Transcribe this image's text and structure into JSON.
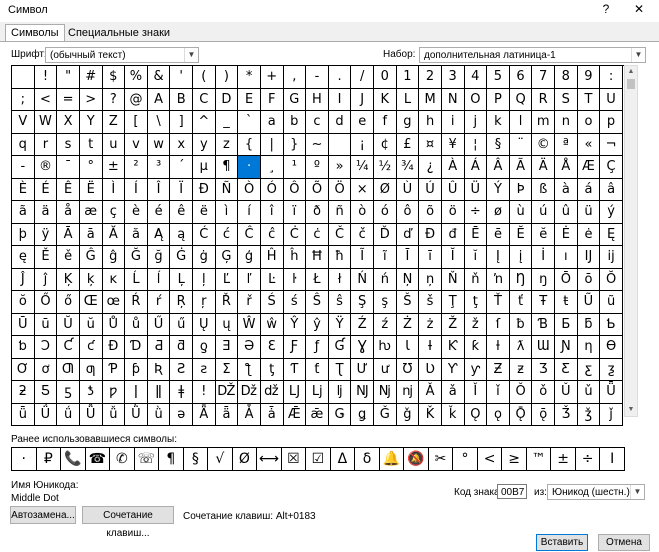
{
  "window": {
    "title": "Символ",
    "help": "?",
    "close": "✕"
  },
  "tabs": [
    {
      "label": "Символы"
    },
    {
      "label": "Специальные знаки"
    }
  ],
  "font": {
    "label": "Шрифт:",
    "value": "(обычный текст)"
  },
  "subset": {
    "label": "Набор:",
    "value": "дополнительная латиница-1"
  },
  "grid_rows": [
    [
      " ",
      "!",
      "\"",
      "#",
      "$",
      "%",
      "&",
      "'",
      "(",
      ")",
      "*",
      "+",
      ",",
      "-",
      ".",
      "/",
      "0",
      "1",
      "2",
      "3",
      "4",
      "5",
      "6",
      "7",
      "8",
      "9",
      ":"
    ],
    [
      ";",
      "<",
      "=",
      ">",
      "?",
      "@",
      "A",
      "B",
      "C",
      "D",
      "E",
      "F",
      "G",
      "H",
      "I",
      "J",
      "K",
      "L",
      "M",
      "N",
      "O",
      "P",
      "Q",
      "R",
      "S",
      "T",
      "U"
    ],
    [
      "V",
      "W",
      "X",
      "Y",
      "Z",
      "[",
      "\\",
      "]",
      "^",
      "_",
      "`",
      "a",
      "b",
      "c",
      "d",
      "e",
      "f",
      "g",
      "h",
      "i",
      "j",
      "k",
      "l",
      "m",
      "n",
      "o",
      "p"
    ],
    [
      "q",
      "r",
      "s",
      "t",
      "u",
      "v",
      "w",
      "x",
      "y",
      "z",
      "{",
      "|",
      "}",
      "~",
      " ",
      "¡",
      "¢",
      "£",
      "¤",
      "¥",
      "¦",
      "§",
      "¨",
      "©",
      "ª",
      "«",
      "¬"
    ],
    [
      "-",
      "®",
      "¯",
      "°",
      "±",
      "²",
      "³",
      "´",
      "µ",
      "¶",
      "·",
      "¸",
      "¹",
      "º",
      "»",
      "¼",
      "½",
      "¾",
      "¿",
      "À",
      "Á",
      "Â",
      "Ã",
      "Ä",
      "Å",
      "Æ",
      "Ç"
    ],
    [
      "È",
      "É",
      "Ê",
      "Ë",
      "Ì",
      "Í",
      "Î",
      "Ï",
      "Ð",
      "Ñ",
      "Ò",
      "Ó",
      "Ô",
      "Õ",
      "Ö",
      "×",
      "Ø",
      "Ù",
      "Ú",
      "Û",
      "Ü",
      "Ý",
      "Þ",
      "ß",
      "à",
      "á",
      "â"
    ],
    [
      "ã",
      "ä",
      "å",
      "æ",
      "ç",
      "è",
      "é",
      "ê",
      "ë",
      "ì",
      "í",
      "î",
      "ï",
      "ð",
      "ñ",
      "ò",
      "ó",
      "ô",
      "õ",
      "ö",
      "÷",
      "ø",
      "ù",
      "ú",
      "û",
      "ü",
      "ý"
    ],
    [
      "þ",
      "ÿ",
      "Ā",
      "ā",
      "Ă",
      "ă",
      "Ą",
      "ą",
      "Ć",
      "ć",
      "Ĉ",
      "ĉ",
      "Ċ",
      "ċ",
      "Č",
      "č",
      "Ď",
      "ď",
      "Đ",
      "đ",
      "Ē",
      "ē",
      "Ĕ",
      "ĕ",
      "Ė",
      "ė",
      "Ę"
    ],
    [
      "ę",
      "Ě",
      "ě",
      "Ĝ",
      "ĝ",
      "Ğ",
      "ğ",
      "Ġ",
      "ġ",
      "Ģ",
      "ģ",
      "Ĥ",
      "ĥ",
      "Ħ",
      "ħ",
      "Ĩ",
      "ĩ",
      "Ī",
      "ī",
      "Ĭ",
      "ĭ",
      "Į",
      "į",
      "İ",
      "ı",
      "Ĳ",
      "ĳ"
    ],
    [
      "Ĵ",
      "ĵ",
      "Ķ",
      "ķ",
      "ĸ",
      "Ĺ",
      "ĺ",
      "Ļ",
      "ļ",
      "Ľ",
      "ľ",
      "Ŀ",
      "ŀ",
      "Ł",
      "ł",
      "Ń",
      "ń",
      "Ņ",
      "ņ",
      "Ň",
      "ň",
      "ŉ",
      "Ŋ",
      "ŋ",
      "Ō",
      "ō",
      "Ŏ"
    ],
    [
      "ŏ",
      "Ő",
      "ő",
      "Œ",
      "œ",
      "Ŕ",
      "ŕ",
      "Ŗ",
      "ŗ",
      "Ř",
      "ř",
      "Ś",
      "ś",
      "Ŝ",
      "ŝ",
      "Ş",
      "ş",
      "Š",
      "š",
      "Ţ",
      "ţ",
      "Ť",
      "ť",
      "Ŧ",
      "ŧ",
      "Ũ",
      "ũ"
    ],
    [
      "Ū",
      "ū",
      "Ŭ",
      "ŭ",
      "Ů",
      "ů",
      "Ű",
      "ű",
      "Ų",
      "ų",
      "Ŵ",
      "ŵ",
      "Ŷ",
      "ŷ",
      "Ÿ",
      "Ź",
      "ź",
      "Ż",
      "ż",
      "Ž",
      "ž",
      "ſ",
      "ƀ",
      "Ɓ",
      "Ƃ",
      "ƃ",
      "Ƅ"
    ],
    [
      "ƅ",
      "Ɔ",
      "Ƈ",
      "ƈ",
      "Ɖ",
      "Ɗ",
      "Ƌ",
      "ƌ",
      "ƍ",
      "Ǝ",
      "Ə",
      "Ɛ",
      "Ƒ",
      "ƒ",
      "Ɠ",
      "Ɣ",
      "ƕ",
      "Ɩ",
      "Ɨ",
      "Ƙ",
      "ƙ",
      "ƚ",
      "ƛ",
      "Ɯ",
      "Ɲ",
      "ƞ",
      "Ɵ"
    ],
    [
      "Ơ",
      "ơ",
      "Ƣ",
      "ƣ",
      "Ƥ",
      "ƥ",
      "Ʀ",
      "Ƨ",
      "ƨ",
      "Ʃ",
      "ƪ",
      "ƫ",
      "Ƭ",
      "ƭ",
      "Ʈ",
      "Ư",
      "ư",
      "Ʊ",
      "Ʋ",
      "Ƴ",
      "ƴ",
      "Ƶ",
      "ƶ",
      "Ʒ",
      "Ƹ",
      "ƹ",
      "ƺ"
    ],
    [
      "ƻ",
      "Ƽ",
      "ƽ",
      "ƾ",
      "ƿ",
      "ǀ",
      "ǁ",
      "ǂ",
      "ǃ",
      "Ǆ",
      "ǅ",
      "ǆ",
      "Ǉ",
      "ǈ",
      "ǉ",
      "Ǌ",
      "ǋ",
      "ǌ",
      "Ǎ",
      "ǎ",
      "Ǐ",
      "ǐ",
      "Ǒ",
      "ǒ",
      "Ǔ",
      "ǔ",
      "Ǖ"
    ],
    [
      "ǖ",
      "Ǘ",
      "ǘ",
      "Ǚ",
      "ǚ",
      "Ǜ",
      "ǜ",
      "ǝ",
      "Ǟ",
      "ǟ",
      "Ǡ",
      "ǡ",
      "Ǣ",
      "ǣ",
      "Ǥ",
      "ǥ",
      "Ǧ",
      "ǧ",
      "Ǩ",
      "ǩ",
      "Ǫ",
      "ǫ",
      "Ǭ",
      "ǭ",
      "Ǯ",
      "ǯ",
      "ǰ"
    ]
  ],
  "selected_symbol": "·",
  "recent": {
    "label": "Ранее использовавшиеся символы:",
    "symbols": [
      "·",
      "₽",
      "📞",
      "☎",
      "✆",
      "☏",
      "¶",
      "§",
      "√",
      "Ø",
      "⟷",
      "☒",
      "☑",
      "Δ",
      "δ",
      "🔔",
      "🔕",
      "✂",
      "°",
      "<",
      "≥",
      "™",
      "±",
      "÷",
      "I"
    ]
  },
  "unicode_name": {
    "label": "Имя Юникода:",
    "value": "Middle Dot"
  },
  "char_code": {
    "label": "Код знака:",
    "value": "00B7"
  },
  "from": {
    "label": "из:",
    "value": "Юникод (шестн.)"
  },
  "buttons": {
    "autocorrect": "Автозамена...",
    "shortcut": "Сочетание клавиш...",
    "insert": "Вставить",
    "cancel": "Отмена"
  },
  "shortcut_text": "Сочетание клавиш: Alt+0183"
}
